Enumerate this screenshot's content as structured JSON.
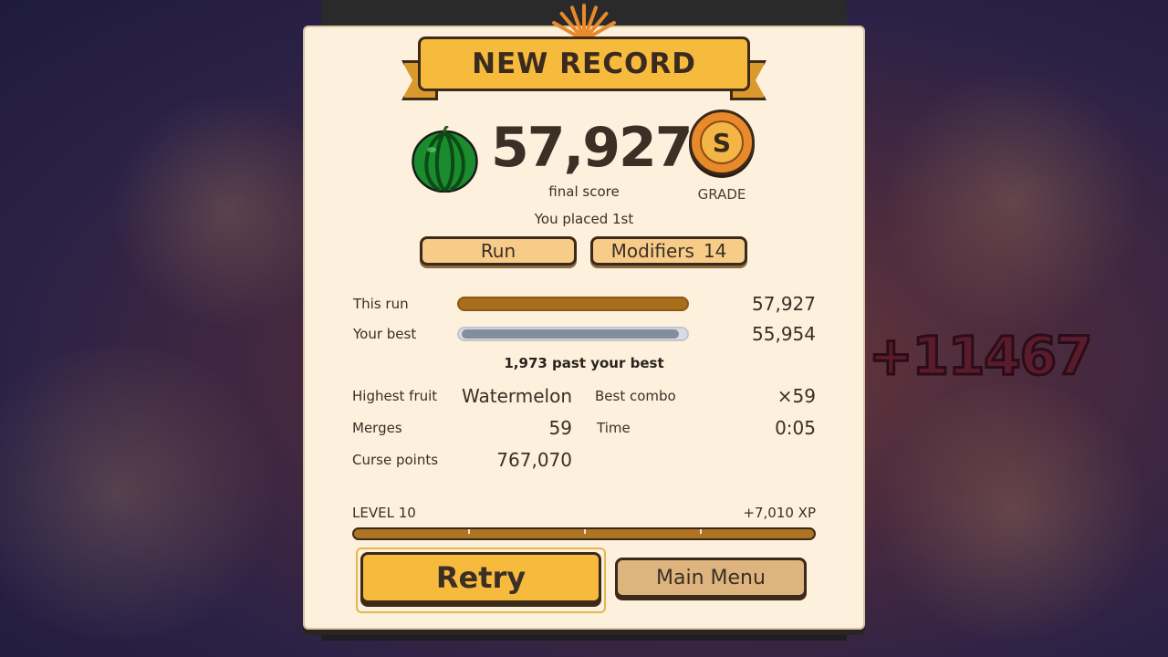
{
  "banner": {
    "title": "NEW RECORD"
  },
  "score": {
    "value": "57,927",
    "label": "final score"
  },
  "grade": {
    "letter": "S",
    "label": "GRADE"
  },
  "placement": "You placed 1st",
  "tabs": {
    "run": "Run",
    "modifiers": "Modifiers",
    "modifiers_count": "14"
  },
  "comparison": {
    "this_run_label": "This run",
    "this_run_value": "57,927",
    "best_label": "Your best",
    "best_value": "55,954",
    "best_fraction": 0.966,
    "delta_text": "1,973 past your best"
  },
  "stats": {
    "highest_fruit_label": "Highest fruit",
    "highest_fruit_value": "Watermelon",
    "best_combo_label": "Best combo",
    "best_combo_value": "×59",
    "merges_label": "Merges",
    "merges_value": "59",
    "time_label": "Time",
    "time_value": "0:05",
    "curse_label": "Curse points",
    "curse_value": "767,070"
  },
  "level": {
    "label": "LEVEL 10",
    "xp_gain": "+7,010 XP",
    "progress": 1.0
  },
  "buttons": {
    "retry": "Retry",
    "main_menu": "Main Menu"
  },
  "background": {
    "popup_text": "+11467"
  },
  "colors": {
    "accent": "#f6bb3d",
    "panel": "#fdf0dc",
    "ink": "#3b2f26",
    "bar_run": "#a86e1e",
    "bar_best": "#838d9b"
  }
}
